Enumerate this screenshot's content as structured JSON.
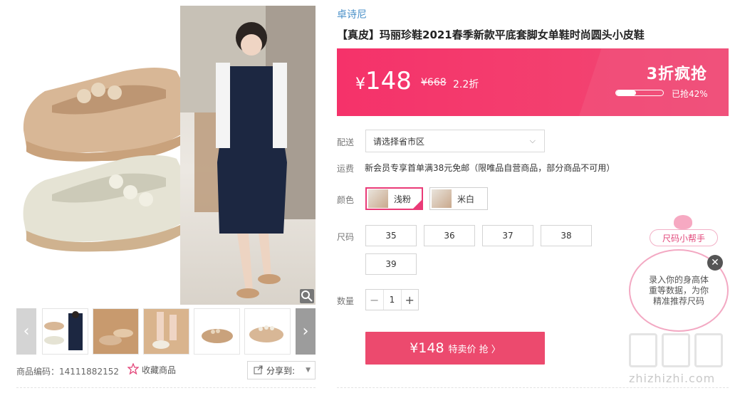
{
  "product": {
    "brand": "卓诗尼",
    "title": "【真皮】玛丽珍鞋2021春季新款平底套脚女单鞋时尚圆头小皮鞋",
    "sku_label": "商品编码：14111882152",
    "favorite_label": "收藏商品",
    "share_label": "分享到:"
  },
  "price": {
    "currency": "¥",
    "current": "148",
    "original": "¥668",
    "discount": "2.2折",
    "promo_title": "3折疯抢",
    "sold_text": "已抢42%",
    "sold_fraction": 0.42
  },
  "shipping": {
    "label": "配送",
    "region_placeholder": "请选择省市区",
    "fee_label": "运费",
    "fee_text": "新会员专享首单满38元免邮（限唯品自营商品，部分商品不可用）"
  },
  "color": {
    "label": "颜色",
    "options": [
      {
        "name": "浅粉",
        "selected": true
      },
      {
        "name": "米白",
        "selected": false
      }
    ]
  },
  "size": {
    "label": "尺码",
    "options": [
      "35",
      "36",
      "37",
      "38",
      "39"
    ]
  },
  "quantity": {
    "label": "数量",
    "value": "1"
  },
  "buy": {
    "price": "¥148",
    "label": "特卖价 抢 〉"
  },
  "size_helper": {
    "tag": "尺码小帮手",
    "bubble_text": "录入你的身高体重等数据，为你精准推荐尺码"
  },
  "watermark": {
    "text": "zhizhizhi.com"
  },
  "colors": {
    "accent": "#f5326a",
    "brand_link": "#4a90c8",
    "buy_button": "#ec4a6e"
  }
}
